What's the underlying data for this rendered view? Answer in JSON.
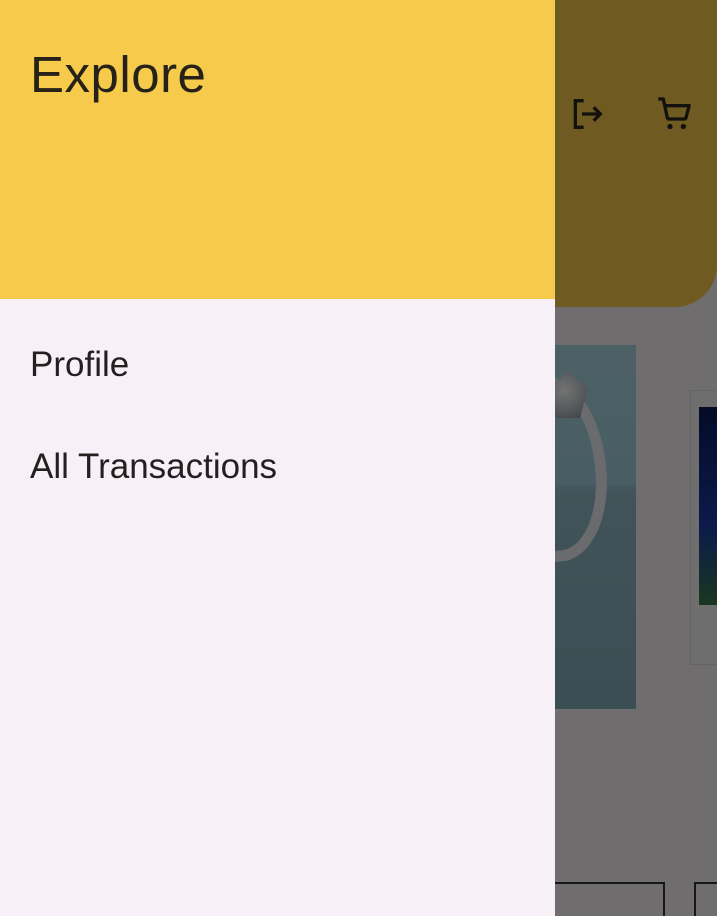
{
  "drawer": {
    "title": "Explore",
    "items": [
      {
        "label": "Profile"
      },
      {
        "label": "All Transactions"
      }
    ]
  },
  "app_bar": {
    "actions": [
      {
        "icon": "logout-icon"
      },
      {
        "icon": "shopping-cart-icon"
      }
    ]
  },
  "colors": {
    "header_yellow": "#F6CA4A",
    "drawer_background": "#F7F1F7",
    "scrim": "rgba(0,0,0,0.55)",
    "text_primary": "#24201F"
  }
}
